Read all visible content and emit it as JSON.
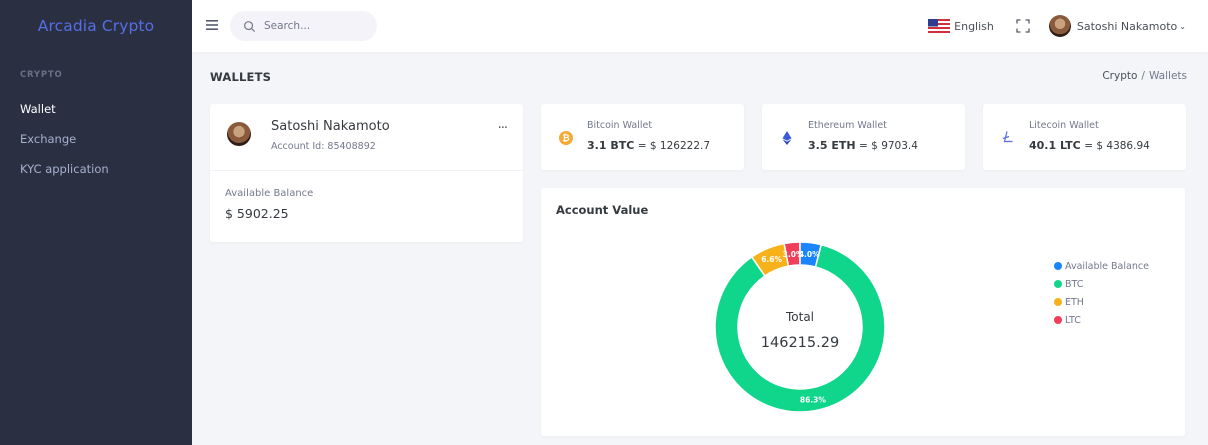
{
  "brand": "Arcadia Crypto",
  "sidebar": {
    "section": "CRYPTO",
    "items": [
      {
        "label": "Wallet",
        "active": true
      },
      {
        "label": "Exchange",
        "active": false
      },
      {
        "label": "KYC application",
        "active": false
      }
    ]
  },
  "topbar": {
    "search_placeholder": "Search...",
    "language": "English",
    "user_name": "Satoshi Nakamoto",
    "caret": "⌄"
  },
  "page": {
    "title": "WALLETS",
    "breadcrumb": [
      "Crypto",
      "Wallets"
    ],
    "breadcrumb_sep": "/"
  },
  "profile": {
    "name": "Satoshi Nakamoto",
    "account_id": "Account Id: 85408892",
    "more": "···",
    "balance_label": "Available Balance",
    "balance_value": "$ 5902.25"
  },
  "wallets": [
    {
      "label": "Bitcoin Wallet",
      "amount": "3.1 BTC",
      "fiat": "= $ 126222.7",
      "icon": "bitcoin-icon",
      "color": "#f7a935"
    },
    {
      "label": "Ethereum Wallet",
      "amount": "3.5 ETH",
      "fiat": "= $ 9703.4",
      "icon": "ethereum-icon",
      "color": "#3b5bdb"
    },
    {
      "label": "Litecoin Wallet",
      "amount": "40.1 LTC",
      "fiat": "= $ 4386.94",
      "icon": "litecoin-icon",
      "color": "#556ee6"
    }
  ],
  "chart_card": {
    "title": "Account Value",
    "center_label": "Total",
    "center_value": "146215.29"
  },
  "chart_data": {
    "type": "pie",
    "donut": true,
    "categories": [
      "Available Balance",
      "BTC",
      "ETH",
      "LTC"
    ],
    "values": [
      4.0,
      86.3,
      6.6,
      3.0
    ],
    "labels": [
      "4.0%",
      "86.3%",
      "6.6%",
      "3.0%"
    ],
    "colors": [
      "#1b84ff",
      "#10d68c",
      "#f7b21b",
      "#ef3f5a"
    ],
    "legend": "right"
  },
  "colors": {
    "sidebar_bg": "#2a3042",
    "accent": "#556ee6"
  }
}
